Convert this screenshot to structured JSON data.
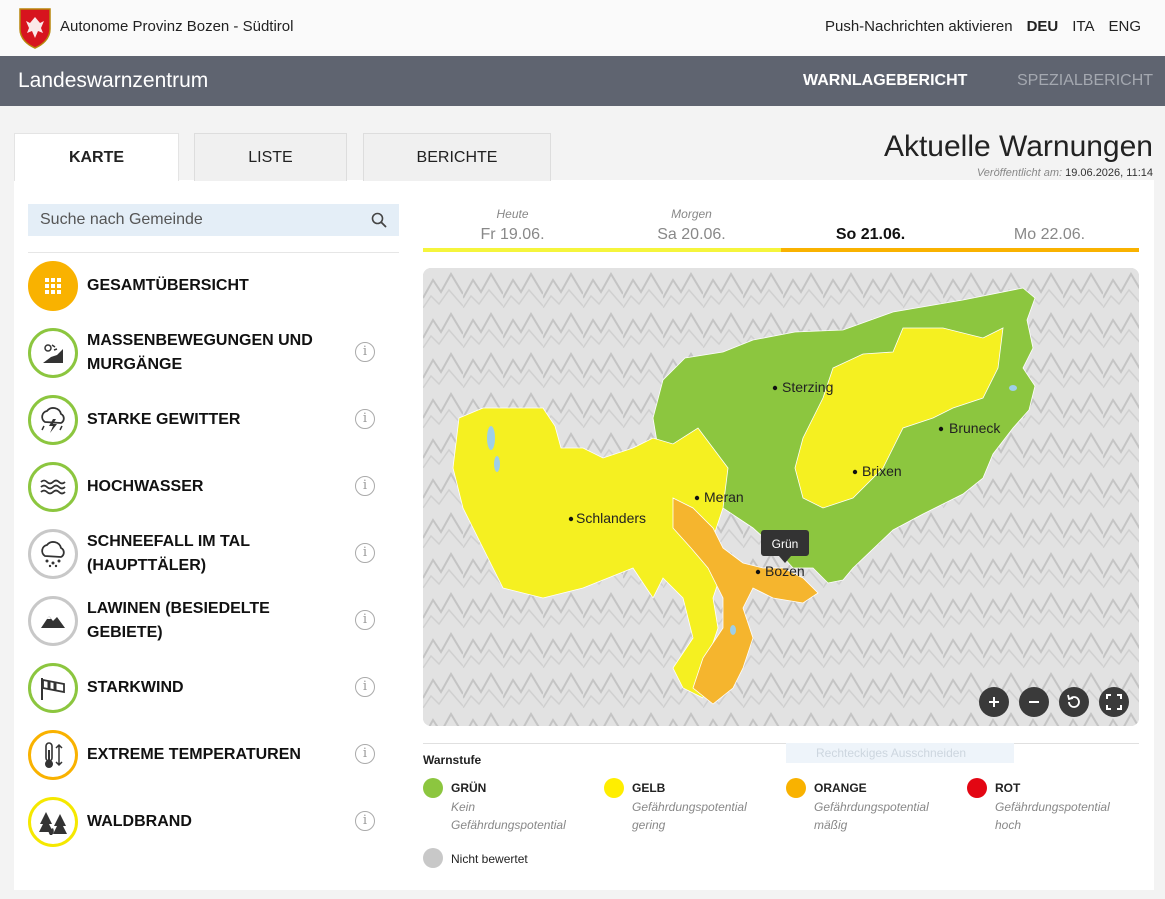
{
  "header": {
    "province": "Autonome Provinz Bozen - Südtirol",
    "push": "Push-Nachrichten aktivieren",
    "languages": [
      "DEU",
      "ITA",
      "ENG"
    ],
    "active_language": "DEU"
  },
  "nav": {
    "site_title": "Landeswarnzentrum",
    "items": [
      "WARNLAGEBERICHT",
      "SPEZIALBERICHT"
    ]
  },
  "tabs": [
    "KARTE",
    "LISTE",
    "BERICHTE"
  ],
  "title": {
    "heading": "Aktuelle Warnungen",
    "published_label": "Veröffentlicht am:",
    "published_value": "19.06.2026, 11:14"
  },
  "search": {
    "placeholder": "Suche nach Gemeinde"
  },
  "categories": [
    {
      "label": "GESAMTÜBERSICHT",
      "icon": "grid-icon",
      "ring": "#f9b200"
    },
    {
      "label": "MASSENBEWEGUNGEN UND MURGÄNGE",
      "icon": "landslide-icon",
      "ring": "#8cc63f"
    },
    {
      "label": "STARKE GEWITTER",
      "icon": "thunderstorm-icon",
      "ring": "#8cc63f"
    },
    {
      "label": "HOCHWASSER",
      "icon": "waves-icon",
      "ring": "#8cc63f"
    },
    {
      "label": "SCHNEEFALL IM TAL (HAUPTTÄLER)",
      "icon": "snow-cloud-icon",
      "ring": "#c8c8c8"
    },
    {
      "label": "LAWINEN (BESIEDELTE GEBIETE)",
      "icon": "avalanche-icon",
      "ring": "#c8c8c8"
    },
    {
      "label": "STARKWIND",
      "icon": "windsock-icon",
      "ring": "#8cc63f"
    },
    {
      "label": "EXTREME TEMPERATUREN",
      "icon": "thermometer-icon",
      "ring": "#f9b200"
    },
    {
      "label": "WALDBRAND",
      "icon": "forest-fire-icon",
      "ring": "#f5e800"
    }
  ],
  "days": [
    {
      "small": "Heute",
      "date": "Fr 19.06.",
      "bar": "#f5f53c"
    },
    {
      "small": "Morgen",
      "date": "Sa 20.06.",
      "bar": "#f5f53c"
    },
    {
      "small": "",
      "date": "So 21.06.",
      "bar": "#f9b200"
    },
    {
      "small": "",
      "date": "Mo 22.06.",
      "bar": "#f9b200"
    }
  ],
  "map": {
    "cities": [
      "Sterzing",
      "Bruneck",
      "Brixen",
      "Meran",
      "Schlanders",
      "Bozen"
    ],
    "tooltip": "Grün"
  },
  "legend": {
    "title": "Warnstufe",
    "items": [
      {
        "name": "GRÜN",
        "desc": "Kein Gefährdungspotential",
        "color": "#8cc63f"
      },
      {
        "name": "GELB",
        "desc": "Gefährdungspotential gering",
        "color": "#ffee00"
      },
      {
        "name": "ORANGE",
        "desc": "Gefährdungspotential mäßig",
        "color": "#f9b200"
      },
      {
        "name": "ROT",
        "desc": "Gefährdungspotential hoch",
        "color": "#e30613"
      }
    ],
    "not_rated": "Nicht bewertet"
  },
  "overlay_hint": "Rechteckiges Ausschneiden"
}
